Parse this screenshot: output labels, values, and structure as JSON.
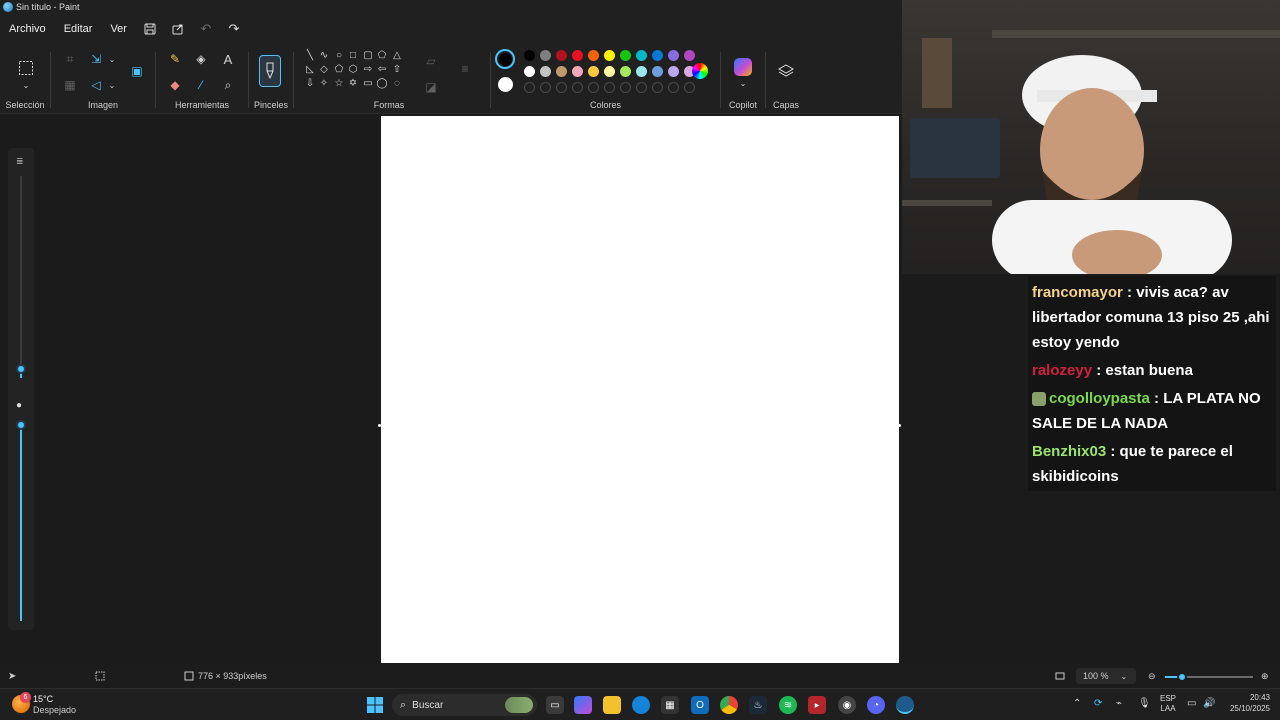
{
  "window": {
    "title": "Sin título - Paint"
  },
  "menu": {
    "items": [
      "Archivo",
      "Editar",
      "Ver"
    ]
  },
  "ribbon": {
    "groups": {
      "seleccion": "Selección",
      "imagen": "Imagen",
      "herramientas": "Herramientas",
      "pinceles": "Pinceles",
      "formas": "Formas",
      "colores": "Colores",
      "copilot": "Copilot",
      "capas": "Capas"
    },
    "colors": {
      "primary": "#000000",
      "secondary": "#ffffff",
      "row1": [
        "#000000",
        "#7f7f7f",
        "#b5101f",
        "#e81224",
        "#f7630c",
        "#fff100",
        "#16c60c",
        "#00b7c3",
        "#0078d4",
        "#886ce4",
        "#b146c2"
      ],
      "row2": [
        "#ffffff",
        "#c3c3c3",
        "#c19a6b",
        "#f4a7b9",
        "#ffc83d",
        "#fff6a0",
        "#a4e95c",
        "#99e7ec",
        "#6ca0dc",
        "#bfa7f0",
        "#d7a9e0"
      ]
    }
  },
  "status": {
    "canvas_size": "776 × 933píxeles",
    "zoom": "100 %",
    "zoom_fraction": 0.18
  },
  "chat": {
    "messages": [
      {
        "user": "francomayor",
        "user_color": "#f5d28c",
        "text": ": vivis aca? av libertador comuna 13 piso 25 ,ahi estoy yendo"
      },
      {
        "user": "ralozeyy",
        "user_color": "#d0203f",
        "text": ": estan buena"
      },
      {
        "user": "cogolloypasta",
        "user_color": "#7bd94a",
        "text": ": LA PLATA NO SALE DE LA NADA"
      },
      {
        "user": "Benzhix03",
        "user_color": "#9be36b",
        "text": ": que te parece el skibidicoins"
      }
    ]
  },
  "taskbar": {
    "weather_temp": "15°C",
    "weather_desc": "Despejado",
    "weather_badge": "6",
    "search_placeholder": "Buscar",
    "lang1": "ESP",
    "lang2": "LAA",
    "time": "20:43",
    "date": "25/10/2025"
  }
}
